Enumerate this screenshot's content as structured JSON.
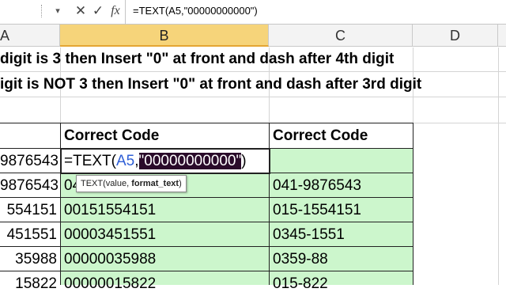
{
  "formula_bar": {
    "function_icon_label": "fx",
    "cancel_icon": "close-icon",
    "enter_icon": "check-icon",
    "formula": "=TEXT(A5,\"00000000000\")"
  },
  "columns": [
    {
      "label": "A",
      "selected": false
    },
    {
      "label": "B",
      "selected": true
    },
    {
      "label": "C",
      "selected": false
    },
    {
      "label": "D",
      "selected": false
    }
  ],
  "notes": [
    "digit is 3 then Insert \"0\" at front and dash after 4th digit",
    "igit is NOT 3 then Insert \"0\" at front and dash after 3rd digit"
  ],
  "table": {
    "headers": [
      "Correct Code",
      "Correct Code"
    ],
    "rows": [
      {
        "a": "9876543",
        "b": "",
        "c": ""
      },
      {
        "a": "9876543",
        "b": "04198765",
        "c": "041-9876543"
      },
      {
        "a": "554151",
        "b": "00151554151",
        "c": "015-1554151"
      },
      {
        "a": "451551",
        "b": "00003451551",
        "c": "0345-1551"
      },
      {
        "a": "35988",
        "b": "00000035988",
        "c": "0359-88"
      },
      {
        "a": "15822",
        "b": "00000015822",
        "c": "015-822"
      }
    ]
  },
  "editor": {
    "prefix": "=TEXT(",
    "ref": "A5",
    "comma": ",",
    "highlighted_arg": "\"00000000000\"",
    "suffix": ")"
  },
  "tooltip": {
    "fn": "TEXT(value, ",
    "bold_arg": "format_text",
    "close": ")"
  },
  "colors": {
    "green_fill": "#ccf6cc",
    "selected_header": "#f6d47a",
    "ref_blue": "#2f5fd6"
  }
}
